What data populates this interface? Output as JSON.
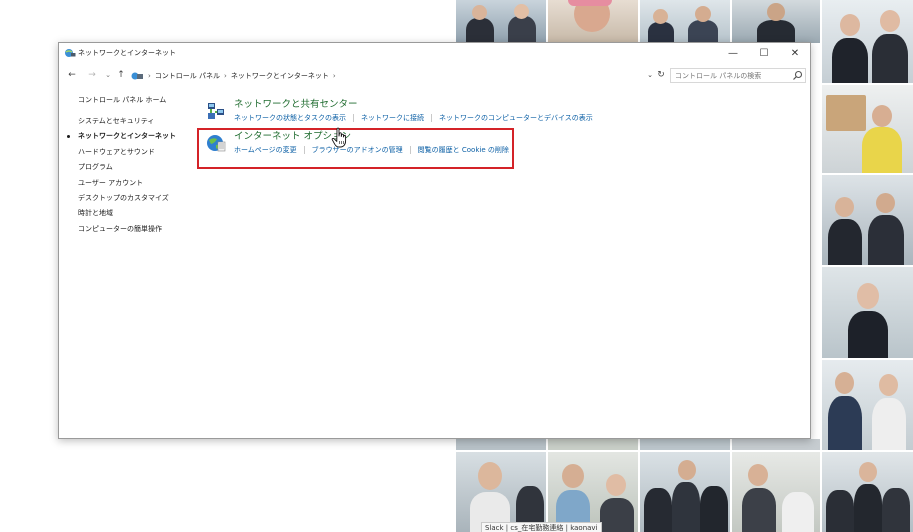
{
  "window": {
    "title": "ネットワークとインターネット",
    "controls": {
      "minimize": "—",
      "maximize": "☐",
      "close": "✕"
    }
  },
  "address_bar": {
    "back": "←",
    "forward": "→",
    "recent": "⌄",
    "up": "↑",
    "path": [
      "コントロール パネル",
      "ネットワークとインターネット"
    ],
    "separator": "›",
    "dropdown": "⌄",
    "refresh": "↻"
  },
  "search": {
    "placeholder": "コントロール パネルの検索"
  },
  "left_nav": {
    "items": [
      {
        "label": "コントロール パネル ホーム"
      },
      {
        "label": "システムとセキュリティ"
      },
      {
        "label": "ネットワークとインターネット",
        "active": true
      },
      {
        "label": "ハードウェアとサウンド"
      },
      {
        "label": "プログラム"
      },
      {
        "label": "ユーザー アカウント"
      },
      {
        "label": "デスクトップのカスタマイズ"
      },
      {
        "label": "時計と地域"
      },
      {
        "label": "コンピューターの簡単操作"
      }
    ]
  },
  "categories": [
    {
      "title": "ネットワークと共有センター",
      "icon": "network-sharing-center-icon",
      "tasks": [
        "ネットワークの状態とタスクの表示",
        "ネットワークに接続",
        "ネットワークのコンピューターとデバイスの表示"
      ]
    },
    {
      "title": "インターネット オプション",
      "icon": "internet-options-globe-icon",
      "tasks": [
        "ホームページの変更",
        "ブラウザーのアドオンの管理",
        "閲覧の履歴と Cookie の削除"
      ]
    }
  ],
  "taskbar_tooltip": "Slack | cs_在宅勤務連絡 | kaonavi",
  "colors": {
    "category_title": "#1e6b2e",
    "link": "#0b5fa5",
    "highlight_box": "#d42328"
  }
}
